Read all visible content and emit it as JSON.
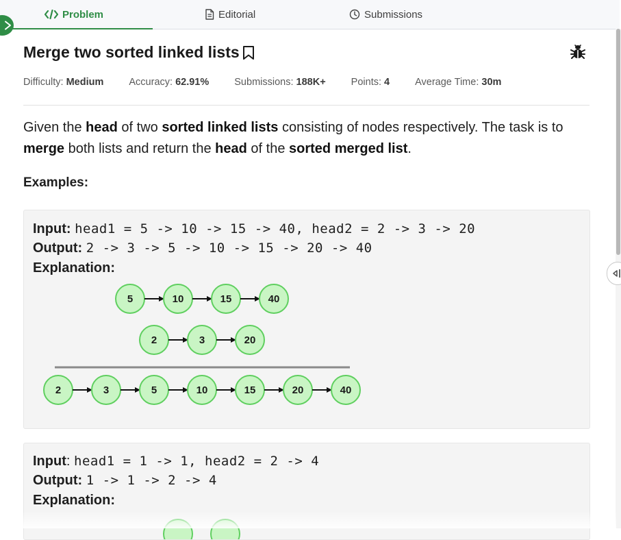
{
  "tabs": [
    {
      "label": "Problem",
      "active": true
    },
    {
      "label": "Editorial",
      "active": false
    },
    {
      "label": "Submissions",
      "active": false
    }
  ],
  "problem": {
    "title": "Merge two sorted linked lists",
    "meta": {
      "difficulty_label": "Difficulty:",
      "difficulty_value": "Medium",
      "accuracy_label": "Accuracy:",
      "accuracy_value": "62.91%",
      "submissions_label": "Submissions:",
      "submissions_value": "188K+",
      "points_label": "Points:",
      "points_value": "4",
      "time_label": "Average Time:",
      "time_value": "30m"
    },
    "description": {
      "p1": "Given the ",
      "b1": "head",
      "p2": " of two ",
      "b2": "sorted linked lists",
      "p3": " consisting of nodes respectively. The task is to ",
      "b3": "merge",
      "p4": " both lists and return the ",
      "b4": "head",
      "p5": " of the ",
      "b5": "sorted merged list",
      "p6": "."
    },
    "examples_heading": "Examples:"
  },
  "examples": [
    {
      "input_label": "Input:",
      "input": "head1 = 5 -> 10 -> 15 -> 40, head2 = 2 -> 3 -> 20",
      "output_label": "Output:",
      "output": "2 -> 3 -> 5 -> 10 -> 15 -> 20 -> 40",
      "explanation_label": "Explanation:",
      "diagram": {
        "list1": [
          "5",
          "10",
          "15",
          "40"
        ],
        "list2": [
          "2",
          "3",
          "20"
        ],
        "merged": [
          "2",
          "3",
          "5",
          "10",
          "15",
          "20",
          "40"
        ]
      }
    },
    {
      "input_label": "Input",
      "input_colon": ":",
      "input": "head1 = 1 -> 1, head2 = 2 -> 4",
      "output_label": "Output:",
      "output": "1 -> 1 -> 2 -> 4",
      "explanation_label": "Explanation:"
    }
  ],
  "colors": {
    "accent": "#2f8d46",
    "node_fill": "#c9f5c4",
    "node_stroke": "#5fcf5f",
    "example_bg": "#f4f4f4"
  },
  "icons": [
    "code-icon",
    "editorial-doc-icon",
    "clock-icon",
    "bookmark-icon",
    "bug-icon",
    "chevron-right-icon",
    "collapse-left-icon"
  ]
}
